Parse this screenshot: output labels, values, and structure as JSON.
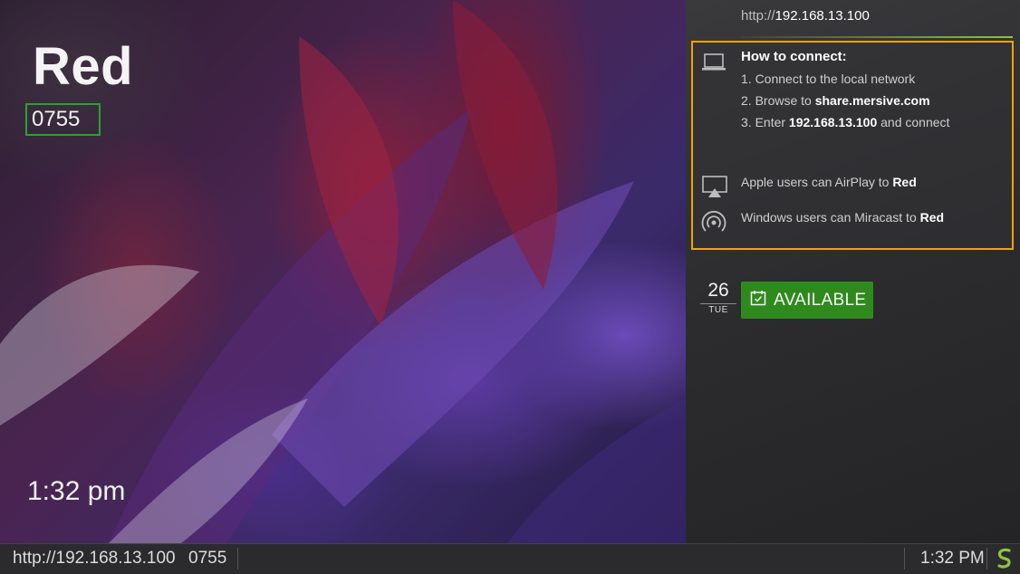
{
  "room": {
    "name": "Red",
    "code": "0755",
    "clock_overlay": "1:32 pm"
  },
  "connection": {
    "url_prefix": "http://",
    "url_host": "192.168.13.100",
    "title": "How to connect:",
    "step1": "1. Connect to the local network",
    "step2_prefix": "2. Browse to ",
    "step2_host": "share.mersive.com",
    "step3_prefix": "3. Enter ",
    "step3_ip": "192.168.13.100",
    "step3_suffix": " and connect",
    "apple_prefix": "Apple users can AirPlay to ",
    "apple_room": "Red",
    "windows_prefix": "Windows users can Miracast to ",
    "windows_room": "Red"
  },
  "calendar": {
    "date": "26",
    "day": "TUE",
    "status": "AVAILABLE"
  },
  "bottom_bar": {
    "url": "http://192.168.13.100",
    "code": "0755",
    "time": "1:32 PM"
  },
  "colors": {
    "highlight_orange": "#f0a20f",
    "highlight_green": "#27a32b",
    "available_green": "#2f8a1e",
    "logo_green": "#8cc63f"
  },
  "icons": {
    "laptop": "laptop-icon",
    "airplay": "airplay-icon",
    "miracast": "miracast-icon",
    "calendar": "calendar-check-icon",
    "logo": "mersive-logo-icon"
  }
}
